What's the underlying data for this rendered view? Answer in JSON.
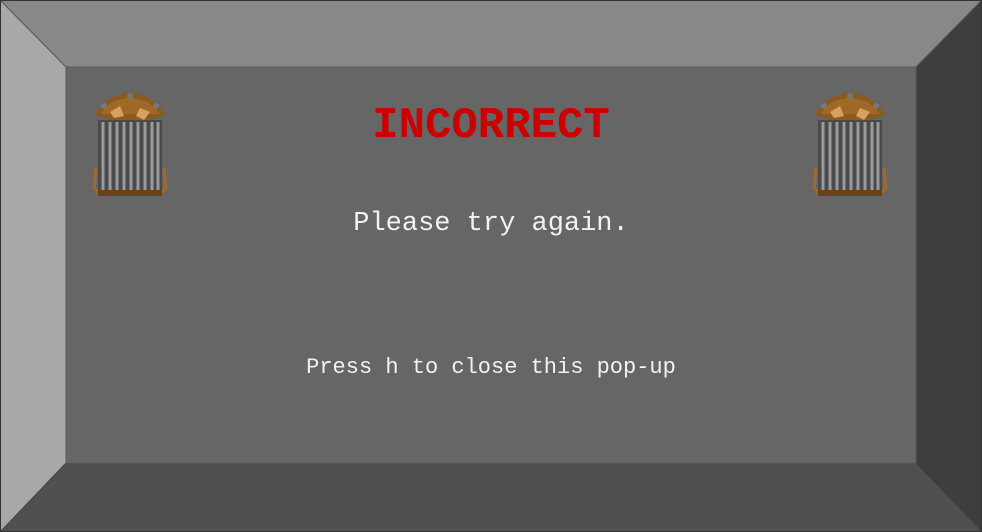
{
  "popup": {
    "title": "INCORRECT",
    "message": "Please try again.",
    "hint": "Press h to close this pop-up"
  },
  "decorations": {
    "left_icon": "trash-can-icon",
    "right_icon": "trash-can-icon"
  },
  "colors": {
    "title": "#cc0000",
    "text": "#f2f2f2",
    "inner_panel": "#666666",
    "bevel_top": "#888888",
    "bevel_left": "#a8a8a8",
    "bevel_right": "#3e3e3e",
    "bevel_bottom": "#505050"
  }
}
